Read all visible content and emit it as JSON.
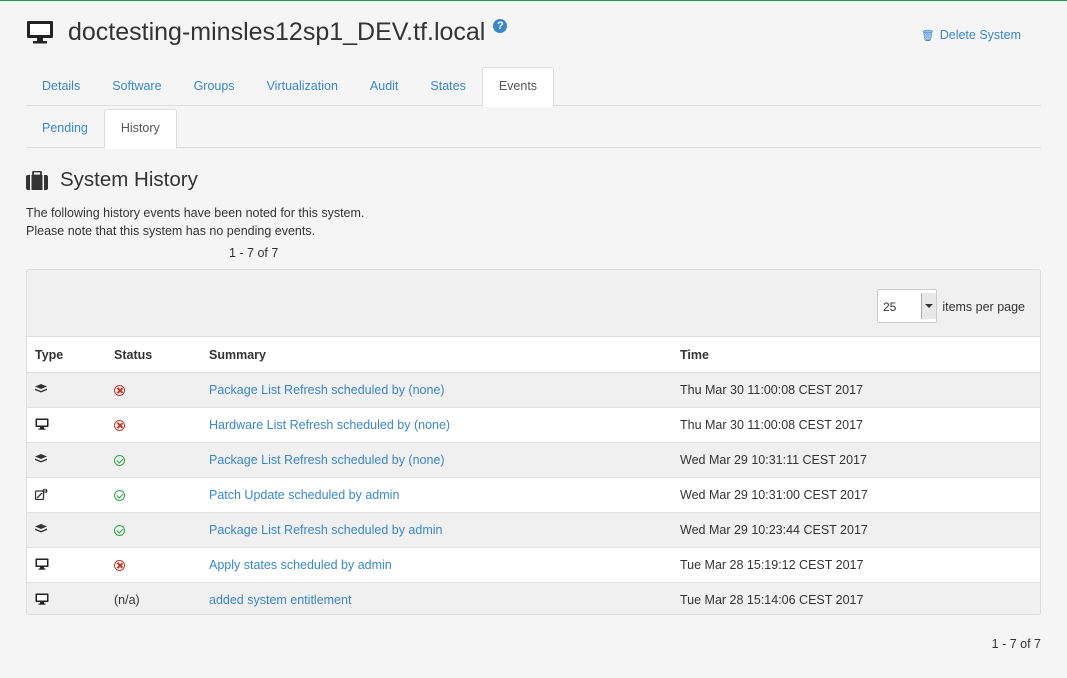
{
  "header": {
    "system_name": "doctesting-minsles12sp1_DEV.tf.local",
    "help_label": "?",
    "delete_label": "Delete System"
  },
  "tabs": [
    {
      "label": "Details",
      "active": false
    },
    {
      "label": "Software",
      "active": false
    },
    {
      "label": "Groups",
      "active": false
    },
    {
      "label": "Virtualization",
      "active": false
    },
    {
      "label": "Audit",
      "active": false
    },
    {
      "label": "States",
      "active": false
    },
    {
      "label": "Events",
      "active": true
    }
  ],
  "subtabs": [
    {
      "label": "Pending",
      "active": false
    },
    {
      "label": "History",
      "active": true
    }
  ],
  "section": {
    "title": "System History",
    "intro_line1": "The following history events have been noted for this system.",
    "intro_line2": "Please note that this system has no pending events.",
    "range": "1 - 7 of 7"
  },
  "pager": {
    "items_per_page": "25",
    "items_per_page_label": "items per page"
  },
  "table": {
    "headers": {
      "type": "Type",
      "status": "Status",
      "summary": "Summary",
      "time": "Time"
    },
    "rows": [
      {
        "type_icon": "packages-icon",
        "status": "failed",
        "status_text": "",
        "summary": "Package List Refresh scheduled by (none)",
        "time": "Thu Mar 30 11:00:08 CEST 2017"
      },
      {
        "type_icon": "desktop-icon",
        "status": "failed",
        "status_text": "",
        "summary": "Hardware List Refresh scheduled by (none)",
        "time": "Thu Mar 30 11:00:08 CEST 2017"
      },
      {
        "type_icon": "packages-icon",
        "status": "completed",
        "status_text": "",
        "summary": "Package List Refresh scheduled by (none)",
        "time": "Wed Mar 29 10:31:11 CEST 2017"
      },
      {
        "type_icon": "patch-icon",
        "status": "completed",
        "status_text": "",
        "summary": "Patch Update scheduled by admin",
        "time": "Wed Mar 29 10:31:00 CEST 2017"
      },
      {
        "type_icon": "packages-icon",
        "status": "completed",
        "status_text": "",
        "summary": "Package List Refresh scheduled by admin",
        "time": "Wed Mar 29 10:23:44 CEST 2017"
      },
      {
        "type_icon": "desktop-icon",
        "status": "failed",
        "status_text": "",
        "summary": "Apply states scheduled by admin",
        "time": "Tue Mar 28 15:19:12 CEST 2017"
      },
      {
        "type_icon": "desktop-icon",
        "status": "na",
        "status_text": "(n/a)",
        "summary": "added system entitlement",
        "time": "Tue Mar 28 15:14:06 CEST 2017"
      }
    ]
  },
  "colors": {
    "accent": "#3a87c8",
    "top_bar": "#2c9a4f",
    "status_failed": "#c0392b",
    "status_ok": "#2fa84f"
  }
}
